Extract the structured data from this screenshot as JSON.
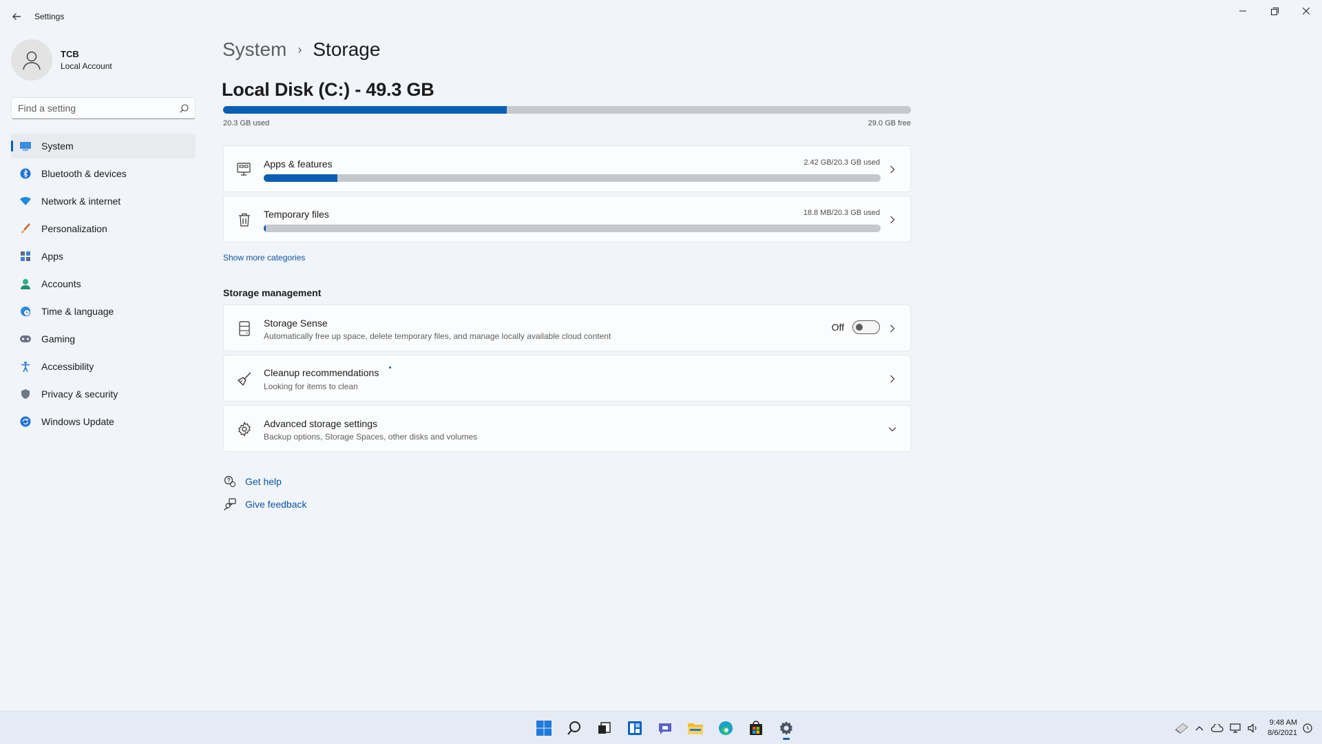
{
  "window": {
    "app_title": "Settings"
  },
  "profile": {
    "name": "TCB",
    "account_type": "Local Account"
  },
  "search": {
    "placeholder": "Find a setting"
  },
  "sidebar": {
    "items": [
      {
        "label": "System",
        "icon": "system-icon",
        "active": true
      },
      {
        "label": "Bluetooth & devices",
        "icon": "bluetooth-icon"
      },
      {
        "label": "Network & internet",
        "icon": "wifi-icon"
      },
      {
        "label": "Personalization",
        "icon": "brush-icon"
      },
      {
        "label": "Apps",
        "icon": "apps-icon"
      },
      {
        "label": "Accounts",
        "icon": "person-icon"
      },
      {
        "label": "Time & language",
        "icon": "globe-clock-icon"
      },
      {
        "label": "Gaming",
        "icon": "gamepad-icon"
      },
      {
        "label": "Accessibility",
        "icon": "accessibility-icon"
      },
      {
        "label": "Privacy & security",
        "icon": "shield-icon"
      },
      {
        "label": "Windows Update",
        "icon": "update-icon"
      }
    ]
  },
  "breadcrumb": {
    "parent": "System",
    "separator": "›",
    "current": "Storage"
  },
  "disk": {
    "title": "Local Disk (C:) - 49.3 GB",
    "used_label": "20.3 GB used",
    "free_label": "29.0 GB free",
    "used_fraction": 0.412
  },
  "categories": [
    {
      "title": "Apps & features",
      "usage": "2.42 GB/20.3 GB used",
      "fraction": 0.119,
      "icon": "apps-features-icon"
    },
    {
      "title": "Temporary files",
      "usage": "18.8 MB/20.3 GB used",
      "fraction": 0.001,
      "icon": "trash-icon"
    }
  ],
  "show_more": "Show more categories",
  "storage_management": {
    "heading": "Storage management",
    "storage_sense": {
      "title": "Storage Sense",
      "subtitle": "Automatically free up space, delete temporary files, and manage locally available cloud content",
      "toggle_label": "Off"
    },
    "cleanup": {
      "title": "Cleanup recommendations",
      "subtitle": "Looking for items to clean"
    },
    "advanced": {
      "title": "Advanced storage settings",
      "subtitle": "Backup options, Storage Spaces, other disks and volumes"
    }
  },
  "links": {
    "get_help": "Get help",
    "give_feedback": "Give feedback"
  },
  "taskbar": {
    "icons": [
      "start-icon",
      "search-icon",
      "task-view-icon",
      "widgets-icon",
      "chat-icon",
      "file-explorer-icon",
      "edge-icon",
      "store-icon",
      "settings-icon"
    ],
    "time": "9:48 AM",
    "date": "8/6/2021"
  },
  "colors": {
    "accent": "#0a5fb4",
    "background": "#f1f4f8",
    "card": "#fbfcfd",
    "bar_track": "#c5c9ce"
  }
}
